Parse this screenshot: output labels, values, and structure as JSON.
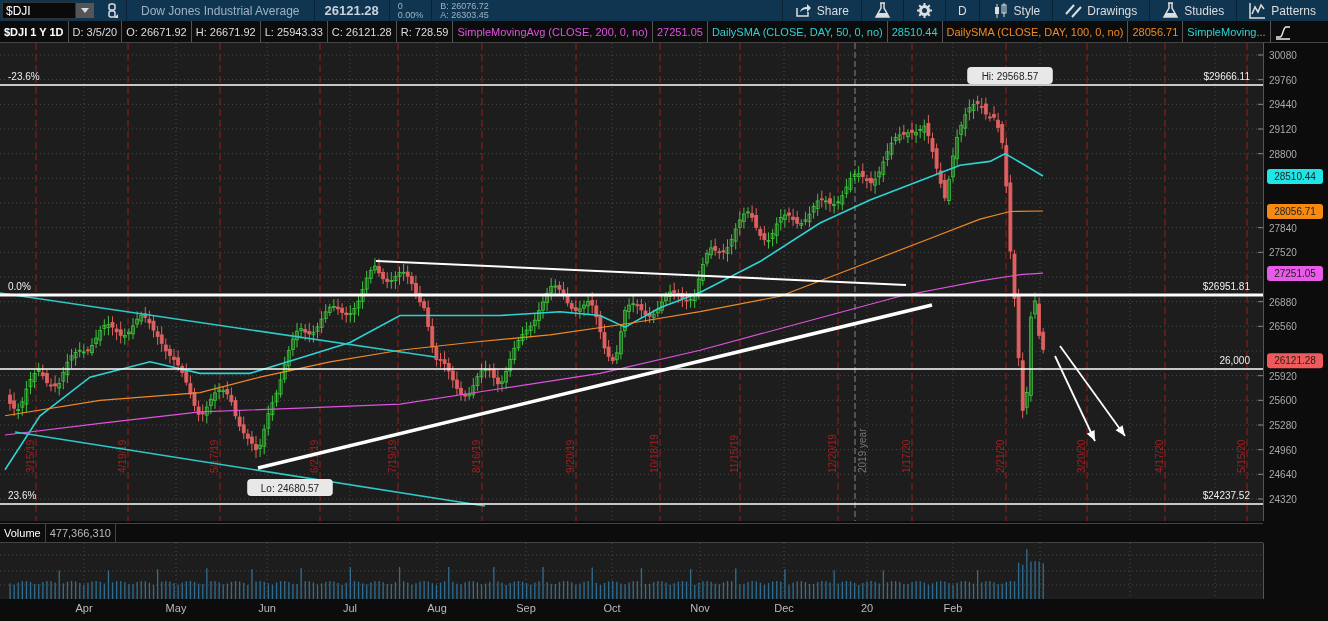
{
  "toolbar": {
    "symbol": "$DJI",
    "name": "Dow Jones Industrial Average",
    "last": "26121.28",
    "change": "0",
    "change_pct": "0.00%",
    "bid": "B: 26076.72",
    "ask": "A: 26303.45",
    "buttons": [
      {
        "label": "Share"
      },
      {
        "label": "D"
      },
      {
        "label": "Style"
      },
      {
        "label": "Drawings"
      },
      {
        "label": "Studies"
      },
      {
        "label": "Patterns"
      }
    ]
  },
  "legend": {
    "title": "$DJI 1 Y 1D",
    "fields": [
      "D: 3/5/20",
      "O: 26671.92",
      "H: 26671.92",
      "L: 25943.33",
      "C: 26121.28",
      "R: 728.59"
    ],
    "studies": [
      {
        "name": "SimpleMovingAvg (CLOSE, 200, 0, no)",
        "value": "27251.05",
        "color": "#e052e0"
      },
      {
        "name": "DailySMA (CLOSE, DAY, 50, 0, no)",
        "value": "28510.44",
        "color": "#2ed3d3"
      },
      {
        "name": "DailySMA (CLOSE, DAY, 100, 0, no)",
        "value": "28056.71",
        "color": "#f08a24"
      },
      {
        "name": "SimpleMoving...",
        "color": "#2ed3d3"
      }
    ]
  },
  "price_chart": {
    "y_ticks": [
      "30080",
      "29760",
      "29440",
      "29120",
      "28800",
      "27840",
      "27520",
      "26880",
      "26560",
      "25920",
      "25600",
      "25280",
      "24960",
      "24640",
      "24320"
    ],
    "levels": [
      {
        "left_label": "-23.6%",
        "right_label": "$29666.11"
      },
      {
        "left_label": "0.0%",
        "right_label": "$26951.81"
      },
      {
        "right_label": "26,000"
      },
      {
        "left_label": "23.6%",
        "right_label": "$24237.52"
      }
    ],
    "date_markers": [
      "3/15/19",
      "4/19/19",
      "5/17/19",
      "6/21/19",
      "7/19/19",
      "8/16/19",
      "9/20/19",
      "10/18/19",
      "11/15/19",
      "12/20/19",
      "1/17/20",
      "2/21/20",
      "3/20/20",
      "4/17/20",
      "5/15/20"
    ],
    "year_marker": "2019 year",
    "callouts": [
      {
        "text": "Hi: 29568.57"
      },
      {
        "text": "Lo: 24680.57"
      }
    ],
    "badges": [
      {
        "text": "28510.44",
        "color": "#1fe6e6"
      },
      {
        "text": "28056.71",
        "color": "#f58a12"
      },
      {
        "text": "27251.05",
        "color": "#e85ae8"
      },
      {
        "text": "26121.28",
        "color": "#f05a5a"
      }
    ]
  },
  "volume": {
    "label": "Volume",
    "value": "477,366,310"
  },
  "months": [
    "Apr",
    "May",
    "Jun",
    "Jul",
    "Aug",
    "Sep",
    "Oct",
    "Nov",
    "Dec",
    "20",
    "Feb"
  ]
}
